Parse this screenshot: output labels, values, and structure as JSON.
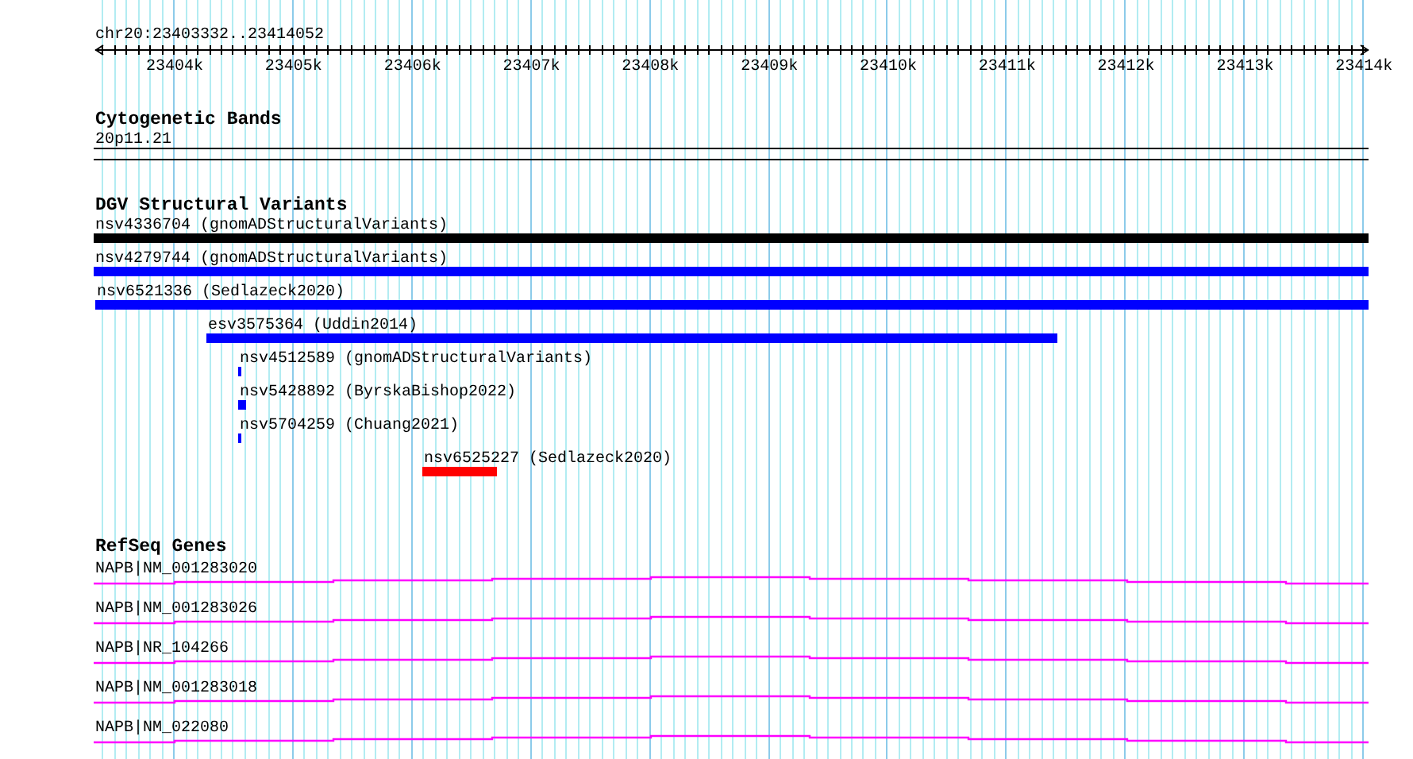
{
  "ruler": {
    "location": "chr20:23403332..23414052",
    "tick_labels": [
      "23404k",
      "23405k",
      "23406k",
      "23407k",
      "23408k",
      "23409k",
      "23410k",
      "23411k",
      "23412k",
      "23413k",
      "23414k"
    ]
  },
  "cytogenetic_bands": {
    "title": "Cytogenetic Bands",
    "band_label": "20p11.21"
  },
  "dgv_structural_variants": {
    "title": "DGV Structural Variants",
    "features": [
      {
        "label": "nsv4336704 (gnomADStructuralVariants)",
        "color": "#000000"
      },
      {
        "label": "nsv4279744 (gnomADStructuralVariants)",
        "color": "#0000ff"
      },
      {
        "label": "nsv6521336 (Sedlazeck2020)",
        "color": "#0000ff"
      },
      {
        "label": "esv3575364 (Uddin2014)",
        "color": "#0000ff"
      },
      {
        "label": "nsv4512589 (gnomADStructuralVariants)",
        "color": "#0000ff"
      },
      {
        "label": "nsv5428892 (ByrskaBishop2022)",
        "color": "#0000ff"
      },
      {
        "label": "nsv5704259 (Chuang2021)",
        "color": "#0000ff"
      },
      {
        "label": "nsv6525227 (Sedlazeck2020)",
        "color": "#ff0000"
      }
    ]
  },
  "refseq_genes": {
    "title": "RefSeq Genes",
    "genes": [
      {
        "label": "NAPB|NM_001283020"
      },
      {
        "label": "NAPB|NM_001283026"
      },
      {
        "label": "NAPB|NR_104266"
      },
      {
        "label": "NAPB|NM_001283018"
      },
      {
        "label": "NAPB|NM_022080"
      }
    ]
  }
}
